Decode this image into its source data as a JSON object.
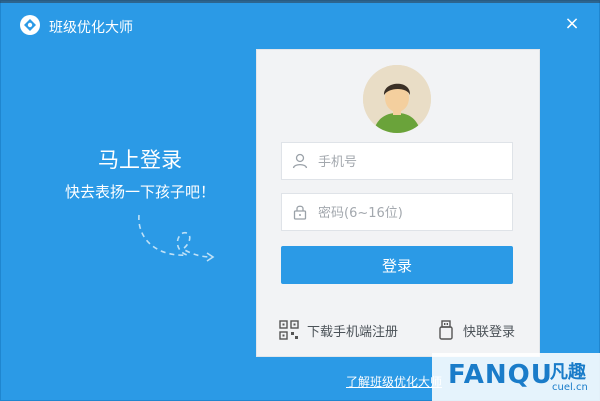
{
  "window": {
    "title": "班级优化大师",
    "close_glyph": "×"
  },
  "promo": {
    "title": "马上登录",
    "subtitle": "快去表扬一下孩子吧！"
  },
  "login": {
    "phone_placeholder": "手机号",
    "password_placeholder": "密码(6~16位)",
    "login_label": "登录",
    "register_link": "下载手机端注册",
    "quick_login_link": "快联登录"
  },
  "footer": {
    "learn_more": "了解班级优化大师"
  },
  "watermark": {
    "text": "FANQU",
    "cn": "凡趣",
    "domain": "cuel.cn"
  },
  "colors": {
    "brand_blue": "#2b9ae6",
    "panel_bg": "#f2f3f5"
  }
}
